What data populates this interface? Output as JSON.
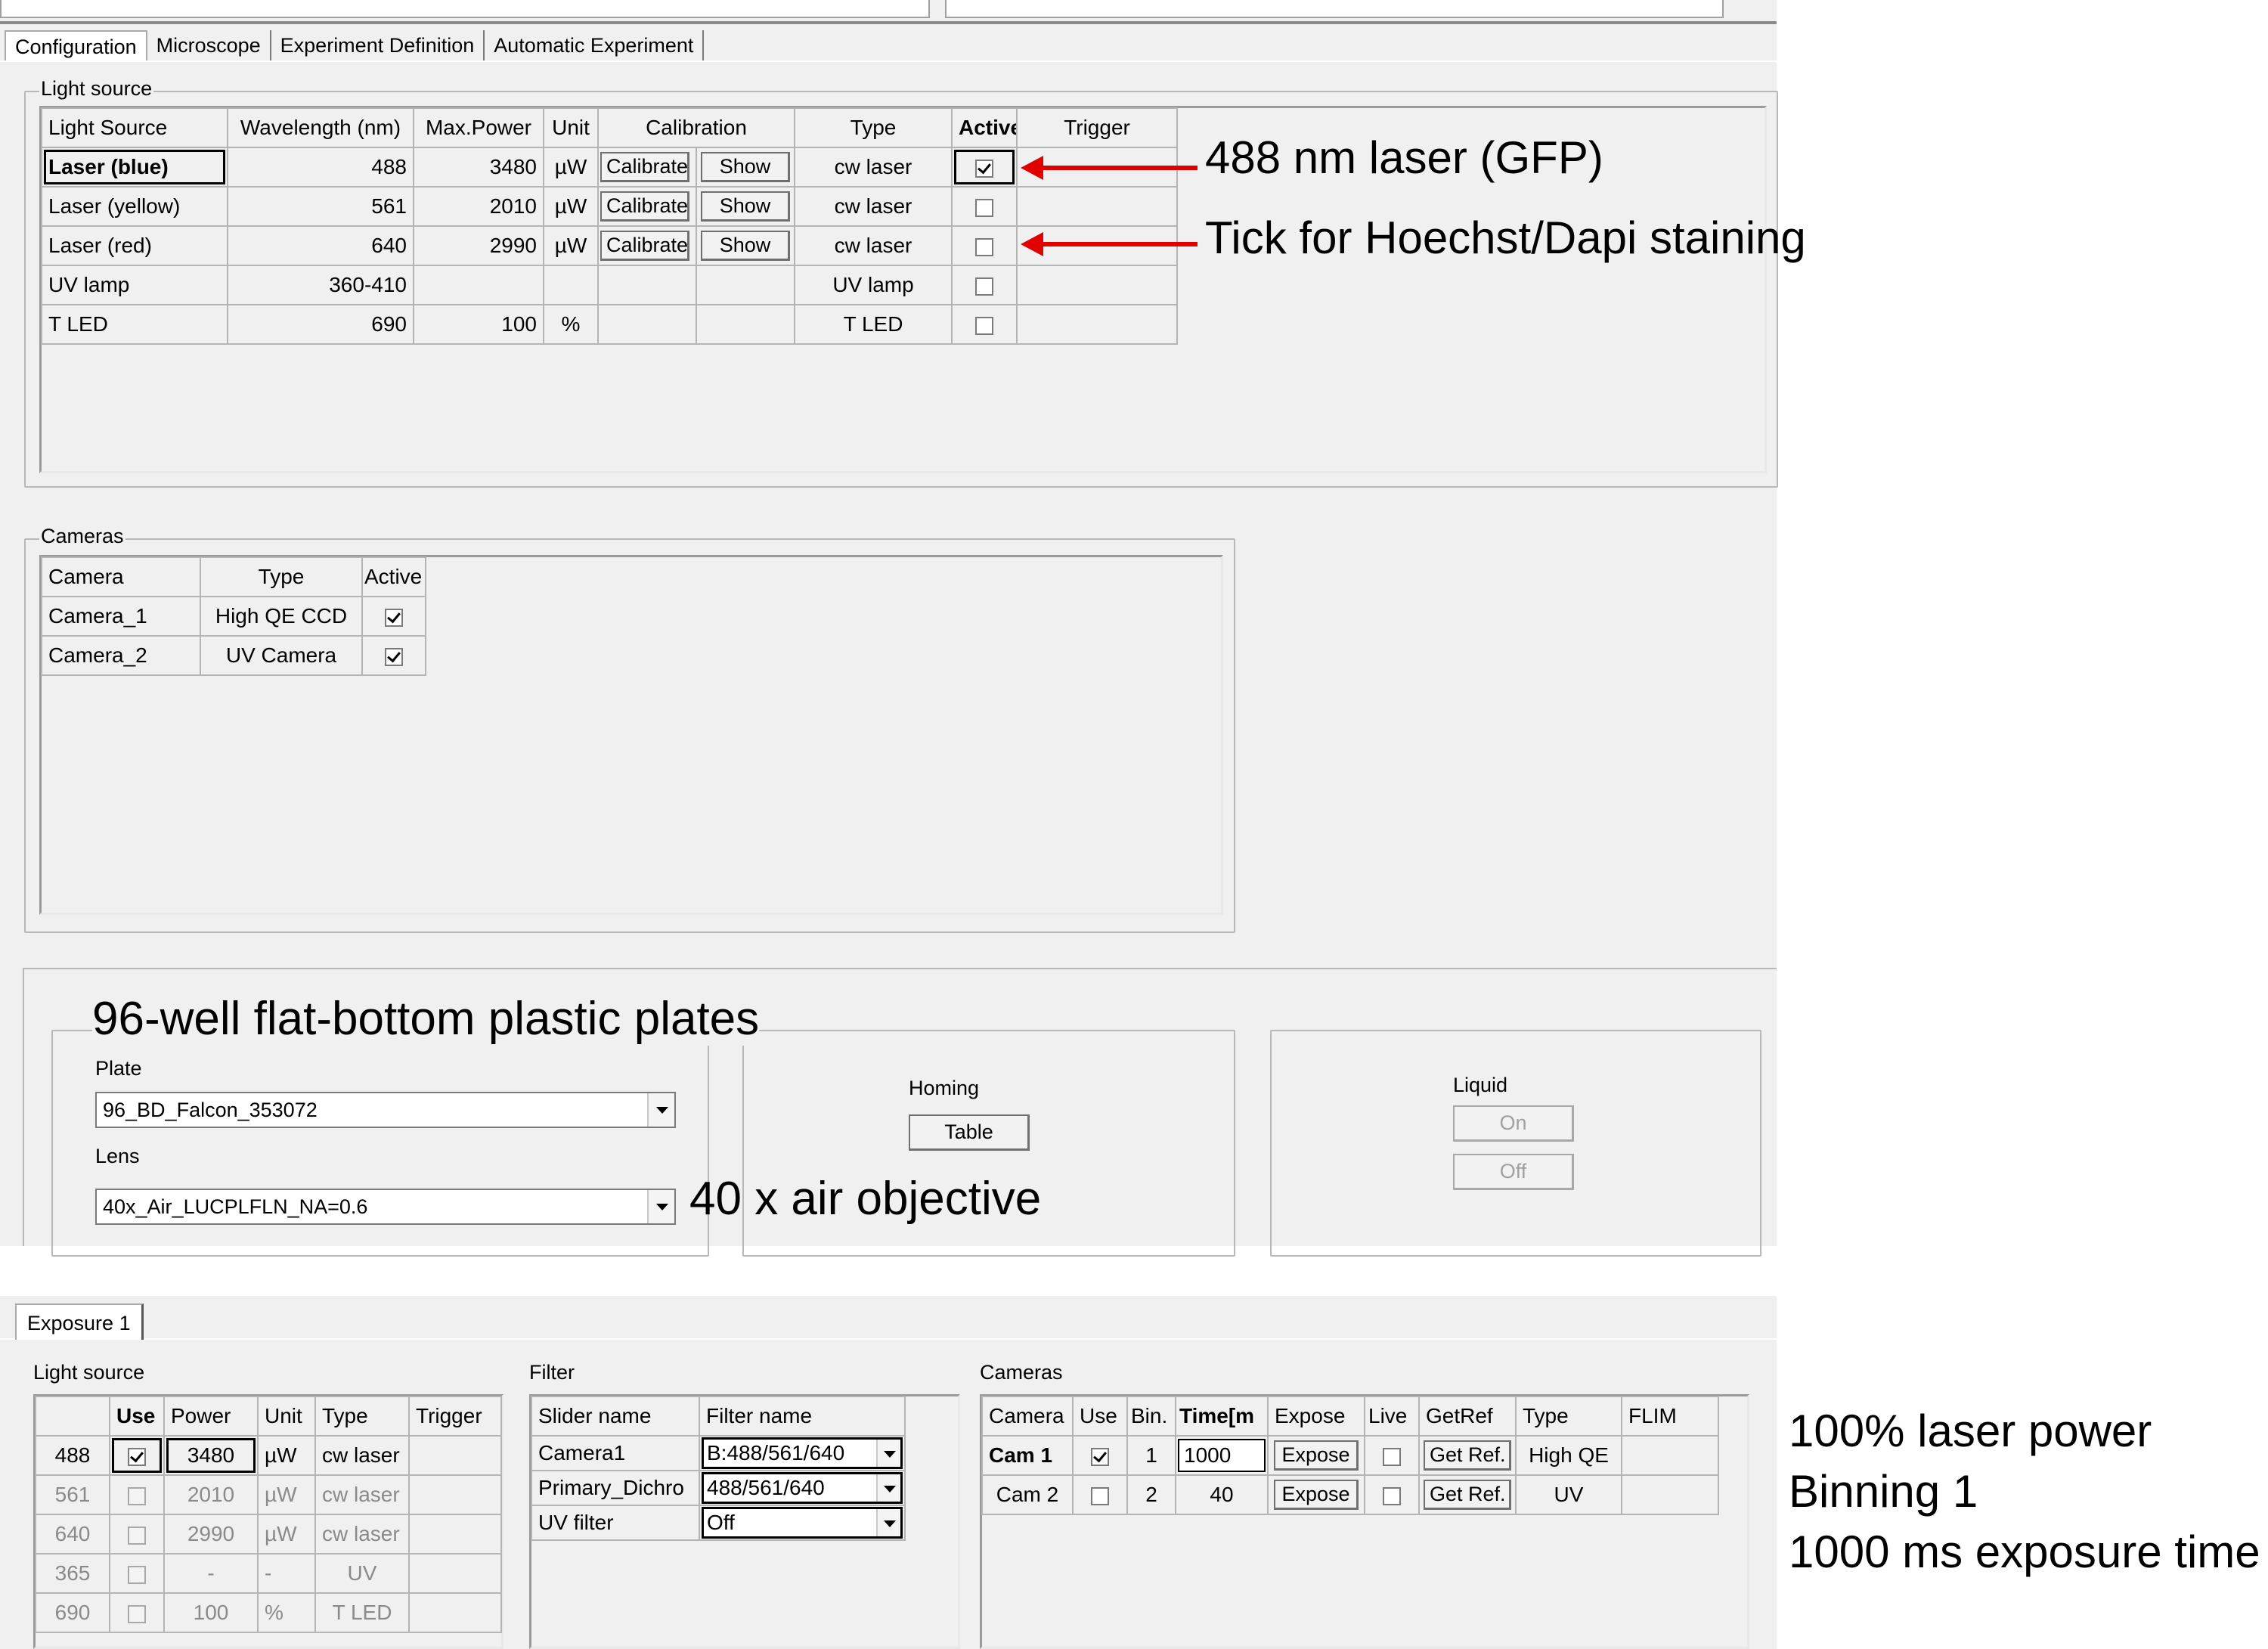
{
  "tabs": [
    "Configuration",
    "Microscope",
    "Experiment Definition",
    "Automatic Experiment"
  ],
  "light_source": {
    "group_label": "Light source",
    "headers": [
      "Light Source",
      "Wavelength (nm)",
      "Max.Power",
      "Unit",
      "Calibration",
      "Type",
      "Active",
      "Trigger"
    ],
    "rows": [
      {
        "name": "Laser (blue)",
        "wavelength": "488",
        "max_power": "3480",
        "unit": "µW",
        "calibrate": "Calibrate",
        "show": "Show",
        "type": "cw laser",
        "active": true
      },
      {
        "name": "Laser (yellow)",
        "wavelength": "561",
        "max_power": "2010",
        "unit": "µW",
        "calibrate": "Calibrate",
        "show": "Show",
        "type": "cw laser",
        "active": false
      },
      {
        "name": "Laser (red)",
        "wavelength": "640",
        "max_power": "2990",
        "unit": "µW",
        "calibrate": "Calibrate",
        "show": "Show",
        "type": "cw laser",
        "active": false
      },
      {
        "name": "UV lamp",
        "wavelength": "360-410",
        "max_power": "",
        "unit": "",
        "calibrate": "",
        "show": "",
        "type": "UV lamp",
        "active": false
      },
      {
        "name": "T LED",
        "wavelength": "690",
        "max_power": "100",
        "unit": "%",
        "calibrate": "",
        "show": "",
        "type": "T LED",
        "active": false
      }
    ]
  },
  "cameras": {
    "group_label": "Cameras",
    "headers": [
      "Camera",
      "Type",
      "Active"
    ],
    "rows": [
      {
        "name": "Camera_1",
        "type": "High QE CCD",
        "active": true
      },
      {
        "name": "Camera_2",
        "type": "UV Camera",
        "active": true
      }
    ]
  },
  "microscope": {
    "plate_label": "Plate",
    "plate_value": "96_BD_Falcon_353072",
    "lens_label": "Lens",
    "lens_value": "40x_Air_LUCPLFLN_NA=0.6",
    "homing_label": "Homing",
    "table_button": "Table",
    "liquid_label": "Liquid",
    "on_button": "On",
    "off_button": "Off"
  },
  "exposure": {
    "tab": "Exposure 1",
    "light_label": "Light source",
    "light_headers": [
      "",
      "Use",
      "Power",
      "Unit",
      "Type",
      "Trigger"
    ],
    "light_rows": [
      {
        "wl": "488",
        "use": true,
        "power": "3480",
        "unit": "µW",
        "type": "cw laser",
        "enabled": true
      },
      {
        "wl": "561",
        "use": false,
        "power": "2010",
        "unit": "µW",
        "type": "cw laser",
        "enabled": false
      },
      {
        "wl": "640",
        "use": false,
        "power": "2990",
        "unit": "µW",
        "type": "cw laser",
        "enabled": false
      },
      {
        "wl": "365",
        "use": false,
        "power": "-",
        "unit": "-",
        "type": "UV",
        "enabled": false
      },
      {
        "wl": "690",
        "use": false,
        "power": "100",
        "unit": "%",
        "type": "T LED",
        "enabled": false
      }
    ],
    "filter_label": "Filter",
    "filter_headers": [
      "Slider name",
      "Filter name"
    ],
    "filter_rows": [
      {
        "slider": "Camera1",
        "filter": "B:488/561/640"
      },
      {
        "slider": "Primary_Dichro",
        "filter": "488/561/640"
      },
      {
        "slider": "UV filter",
        "filter": "Off"
      }
    ],
    "cameras_label": "Cameras",
    "camera_headers": [
      "Camera",
      "Use",
      "Bin.",
      "Time[m",
      "Expose",
      "Live",
      "GetRef",
      "Type",
      "FLIM"
    ],
    "camera_rows": [
      {
        "name": "Cam 1",
        "use": true,
        "bin": "1",
        "time": "1000",
        "expose": "Expose",
        "live": false,
        "getref": "Get Ref.",
        "type": "High QE"
      },
      {
        "name": "Cam 2",
        "use": false,
        "bin": "2",
        "time": "40",
        "expose": "Expose",
        "live": false,
        "getref": "Get Ref.",
        "type": "UV"
      }
    ]
  },
  "annotations": {
    "gfp": "488 nm laser (GFP)",
    "hoechst": "Tick for Hoechst/Dapi staining",
    "plates": "96-well flat-bottom plastic plates",
    "objective": "40 x air objective",
    "settings": [
      "100% laser power",
      "Binning 1",
      "1000 ms exposure time"
    ]
  },
  "colors": {
    "arrow": "#e00000",
    "window": "#f0f0f0"
  }
}
